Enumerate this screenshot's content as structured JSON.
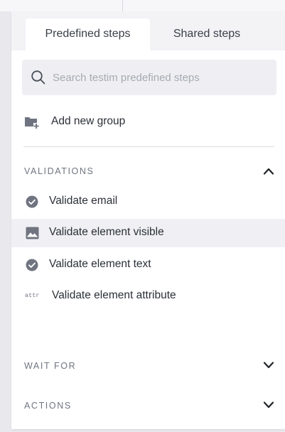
{
  "tabs": [
    {
      "label": "Predefined steps",
      "active": true
    },
    {
      "label": "Shared steps",
      "active": false
    }
  ],
  "search": {
    "placeholder": "Search testim predefined steps",
    "value": "",
    "icon": "search-icon"
  },
  "add_group": {
    "label": "Add new group",
    "icon": "folder-plus-icon"
  },
  "sections": {
    "validations": {
      "title": "VALIDATIONS",
      "expanded": true,
      "items": [
        {
          "label": "Validate email",
          "icon": "check-circle-icon"
        },
        {
          "label": "Validate element visible",
          "icon": "image-icon"
        },
        {
          "label": "Validate element text",
          "icon": "check-circle-icon"
        },
        {
          "label": "Validate element attribute",
          "icon_text": "attr"
        }
      ]
    },
    "wait_for": {
      "title": "WAIT FOR",
      "expanded": false
    },
    "actions": {
      "title": "ACTIONS",
      "expanded": false
    }
  },
  "colors": {
    "accent_bg": "#f0f0f4",
    "icon_gray": "#6f7480",
    "text": "#2b2f36"
  }
}
